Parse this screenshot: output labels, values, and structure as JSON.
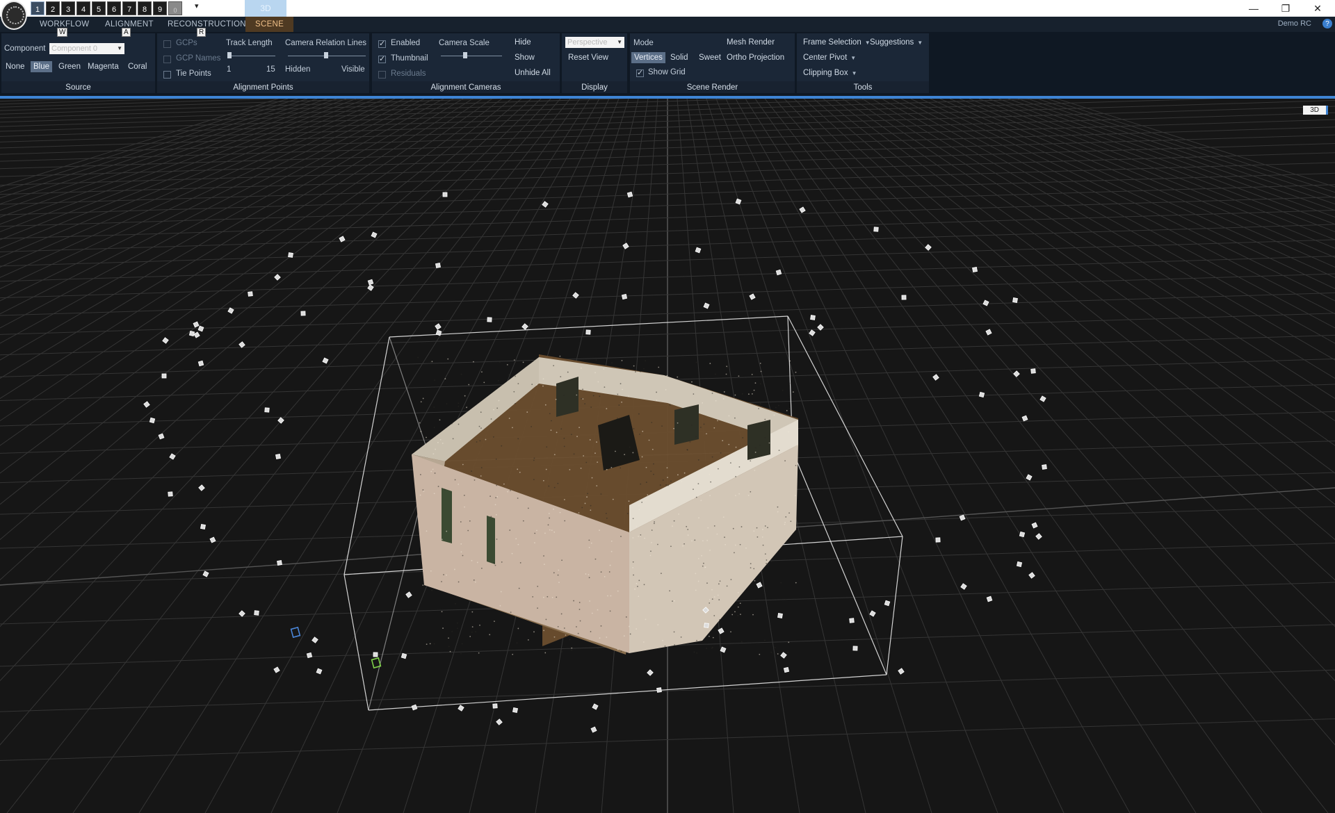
{
  "title_bar": {
    "layout_buttons": [
      "1",
      "2",
      "3",
      "4",
      "5",
      "6",
      "7",
      "8",
      "9",
      "0"
    ],
    "active_layout": "1",
    "view_tab": "3D",
    "window_controls": {
      "minimize": "—",
      "restore": "❐",
      "close": "✕"
    }
  },
  "tabs": {
    "workflow": "WORKFLOW",
    "alignment": "ALIGNMENT",
    "reconstruction": "RECONSTRUCTION",
    "scene": "SCENE",
    "keytips": {
      "workflow": "W",
      "alignment": "A",
      "reconstruction": "R"
    }
  },
  "account": {
    "name": "Demo RC",
    "help": "?"
  },
  "ribbon": {
    "source": {
      "label": "Source",
      "component_label": "Component",
      "component_value": "Component 0",
      "colors": [
        "None",
        "Blue",
        "Green",
        "Magenta",
        "Coral"
      ],
      "selected_color": "Blue"
    },
    "alignment_points": {
      "label": "Alignment Points",
      "gcps": "GCPs",
      "gcp_names": "GCP Names",
      "tie_points": "Tie Points",
      "track_length": "Track Length",
      "track_min": "1",
      "track_max": "15",
      "camera_relation_lines": "Camera Relation Lines",
      "hidden": "Hidden",
      "visible": "Visible"
    },
    "alignment_cameras": {
      "label": "Alignment Cameras",
      "enabled": "Enabled",
      "thumbnail": "Thumbnail",
      "residuals": "Residuals",
      "camera_scale": "Camera Scale",
      "hide": "Hide",
      "show": "Show",
      "unhide_all": "Unhide All"
    },
    "display": {
      "label": "Display",
      "projection": "Perspective",
      "reset_view": "Reset View"
    },
    "scene_render": {
      "label": "Scene Render",
      "mode": "Mode",
      "mode_options": [
        "Vertices",
        "Solid",
        "Sweet"
      ],
      "selected_mode": "Vertices",
      "mesh_render": "Mesh Render",
      "ortho_projection": "Ortho Projection",
      "show_grid": "Show Grid"
    },
    "tools": {
      "label": "Tools",
      "frame_selection": "Frame Selection",
      "suggestions": "Suggestions",
      "center_pivot": "Center Pivot",
      "clipping_box": "Clipping Box"
    }
  },
  "viewport": {
    "mode_badge": "3D"
  },
  "colors": {
    "accent": "#3e84d4",
    "active_tab": "#4f3a22",
    "ribbon": "#1b2737",
    "bbox": "#e8e8e8"
  }
}
